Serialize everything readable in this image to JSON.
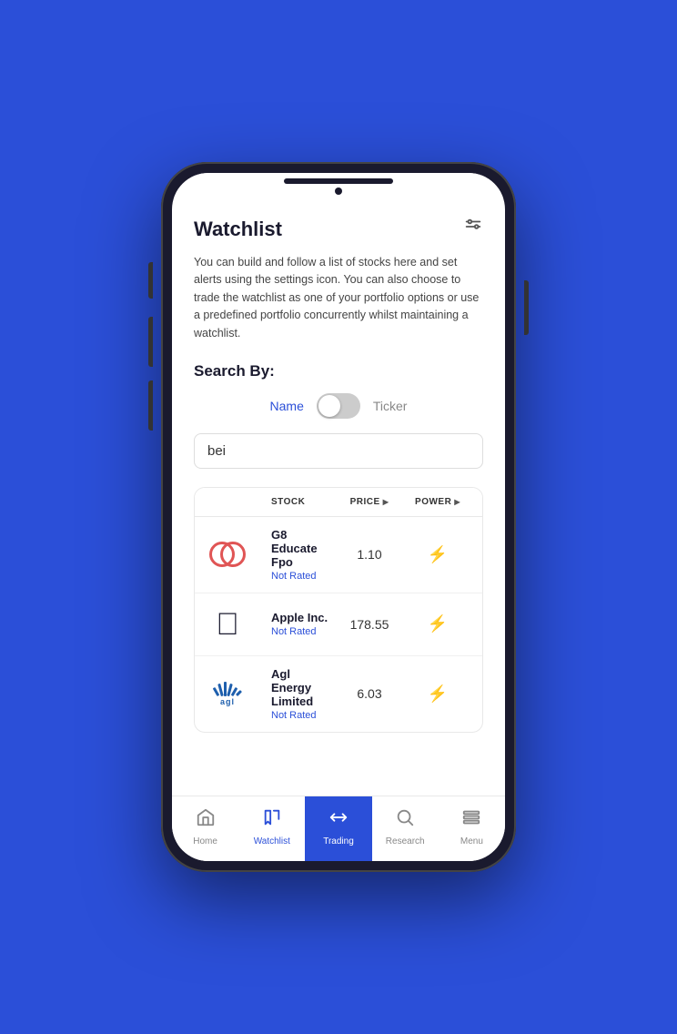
{
  "page": {
    "title": "Watchlist",
    "description": "You can build and follow a list of stocks here and set alerts using the settings icon. You can also choose to trade the watchlist as one of your portfolio options or use a predefined portfolio concurrently whilst maintaining a watchlist.",
    "search_by_label": "Search By:",
    "toggle": {
      "left_label": "Name",
      "right_label": "Ticker",
      "position": "left"
    },
    "search_input": {
      "value": "bei",
      "placeholder": "bei"
    },
    "table": {
      "columns": [
        {
          "label": "",
          "key": "logo"
        },
        {
          "label": "STOCK",
          "key": "stock"
        },
        {
          "label": "PRICE",
          "key": "price",
          "sortable": true
        },
        {
          "label": "POWER",
          "key": "power",
          "sortable": true
        }
      ],
      "rows": [
        {
          "id": 1,
          "name": "G8 Educate Fpo",
          "rating": "Not Rated",
          "price": "1.10",
          "logo_type": "g8"
        },
        {
          "id": 2,
          "name": "Apple Inc.",
          "rating": "Not Rated",
          "price": "178.55",
          "logo_type": "apple"
        },
        {
          "id": 3,
          "name": "Agl Energy Limited",
          "rating": "Not Rated",
          "price": "6.03",
          "logo_type": "agl"
        }
      ]
    }
  },
  "nav": {
    "items": [
      {
        "id": "home",
        "label": "Home",
        "icon": "home",
        "active": false
      },
      {
        "id": "watchlist",
        "label": "Watchlist",
        "icon": "flag",
        "active": false,
        "highlight": true
      },
      {
        "id": "trading",
        "label": "Trading",
        "icon": "trading",
        "active": true
      },
      {
        "id": "research",
        "label": "Research",
        "icon": "search",
        "active": false
      },
      {
        "id": "menu",
        "label": "Menu",
        "icon": "menu",
        "active": false
      }
    ]
  }
}
